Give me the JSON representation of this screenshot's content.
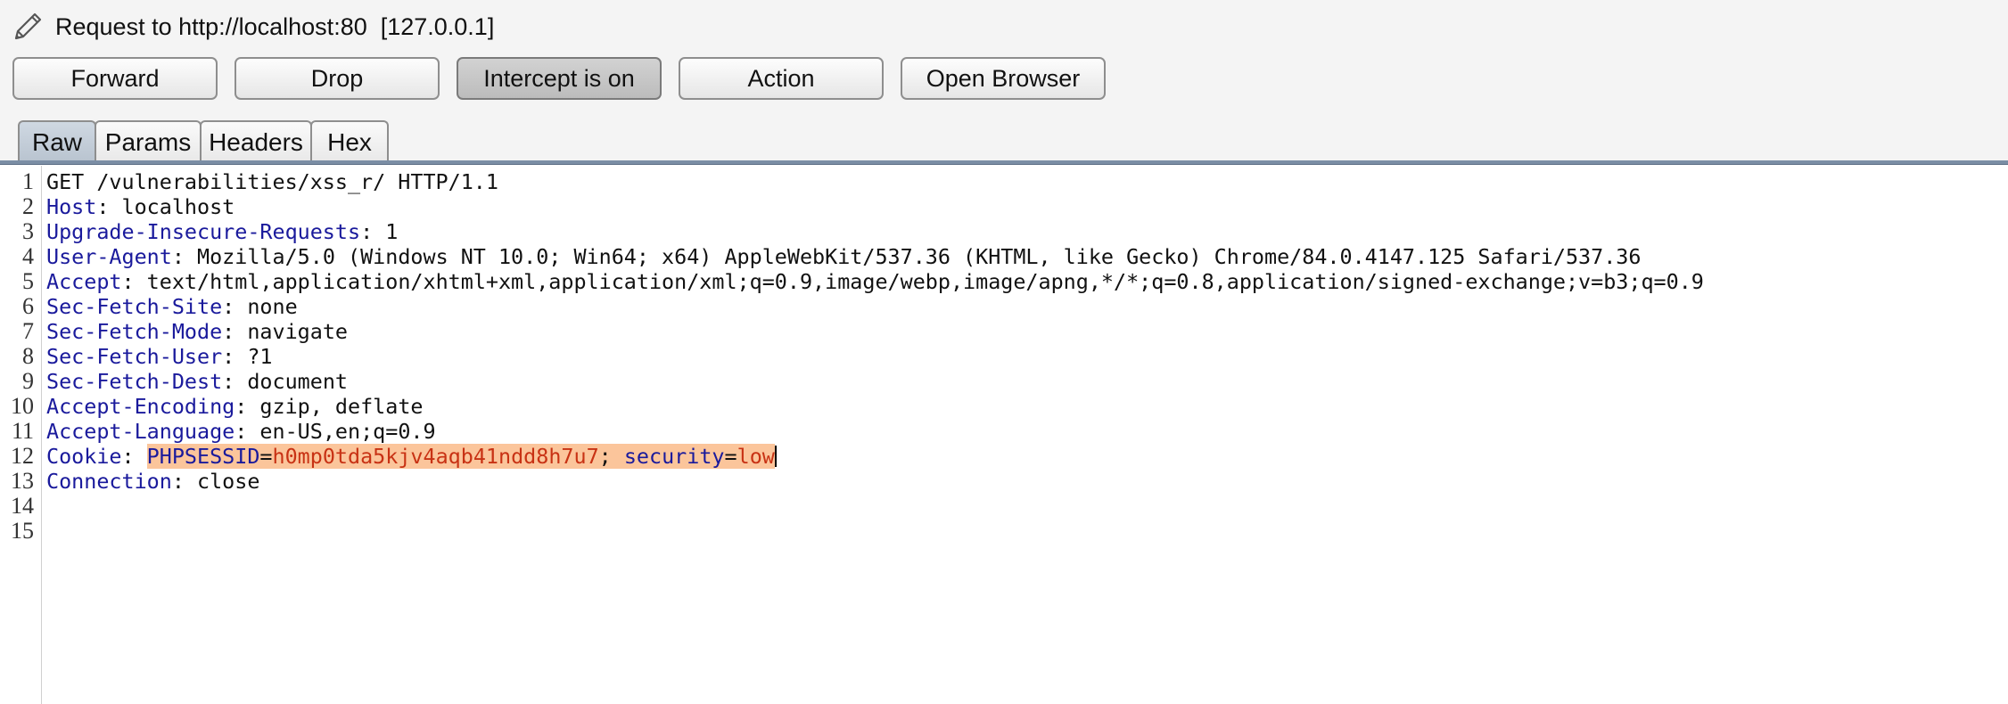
{
  "header": {
    "title": "Request to http://localhost:80  [127.0.0.1]",
    "icon": "pencil-icon"
  },
  "toolbar": {
    "forward_label": "Forward",
    "drop_label": "Drop",
    "intercept_label": "Intercept is on",
    "action_label": "Action",
    "open_browser_label": "Open Browser"
  },
  "tabs": [
    {
      "label": "Raw",
      "active": true
    },
    {
      "label": "Params",
      "active": false
    },
    {
      "label": "Headers",
      "active": false
    },
    {
      "label": "Hex",
      "active": false
    }
  ],
  "request": {
    "line_numbers": [
      "1",
      "2",
      "3",
      "4",
      "5",
      "6",
      "7",
      "8",
      "9",
      "10",
      "11",
      "12",
      "13",
      "14",
      "15"
    ],
    "request_line": "GET /vulnerabilities/xss_r/ HTTP/1.1",
    "headers": [
      {
        "name": "Host",
        "value": "localhost"
      },
      {
        "name": "Upgrade-Insecure-Requests",
        "value": "1"
      },
      {
        "name": "User-Agent",
        "value": "Mozilla/5.0 (Windows NT 10.0; Win64; x64) AppleWebKit/537.36 (KHTML, like Gecko) Chrome/84.0.4147.125 Safari/537.36"
      },
      {
        "name": "Accept",
        "value": "text/html,application/xhtml+xml,application/xml;q=0.9,image/webp,image/apng,*/*;q=0.8,application/signed-exchange;v=b3;q=0.9"
      },
      {
        "name": "Sec-Fetch-Site",
        "value": "none"
      },
      {
        "name": "Sec-Fetch-Mode",
        "value": "navigate"
      },
      {
        "name": "Sec-Fetch-User",
        "value": "?1"
      },
      {
        "name": "Sec-Fetch-Dest",
        "value": "document"
      },
      {
        "name": "Accept-Encoding",
        "value": "gzip, deflate"
      },
      {
        "name": "Accept-Language",
        "value": "en-US,en;q=0.9"
      }
    ],
    "cookie": {
      "name": "Cookie",
      "pairs": [
        {
          "name": "PHPSESSID",
          "value": "h0mp0tda5kjv4aqb41ndd8h7u7"
        },
        {
          "name": "security",
          "value": "low"
        }
      ]
    },
    "connection": {
      "name": "Connection",
      "value": "close"
    }
  },
  "colors": {
    "header_name": "#1a1a9c",
    "cookie_value": "#c83214",
    "selection": "#fbc59b",
    "divider": "#7b8ea5"
  }
}
